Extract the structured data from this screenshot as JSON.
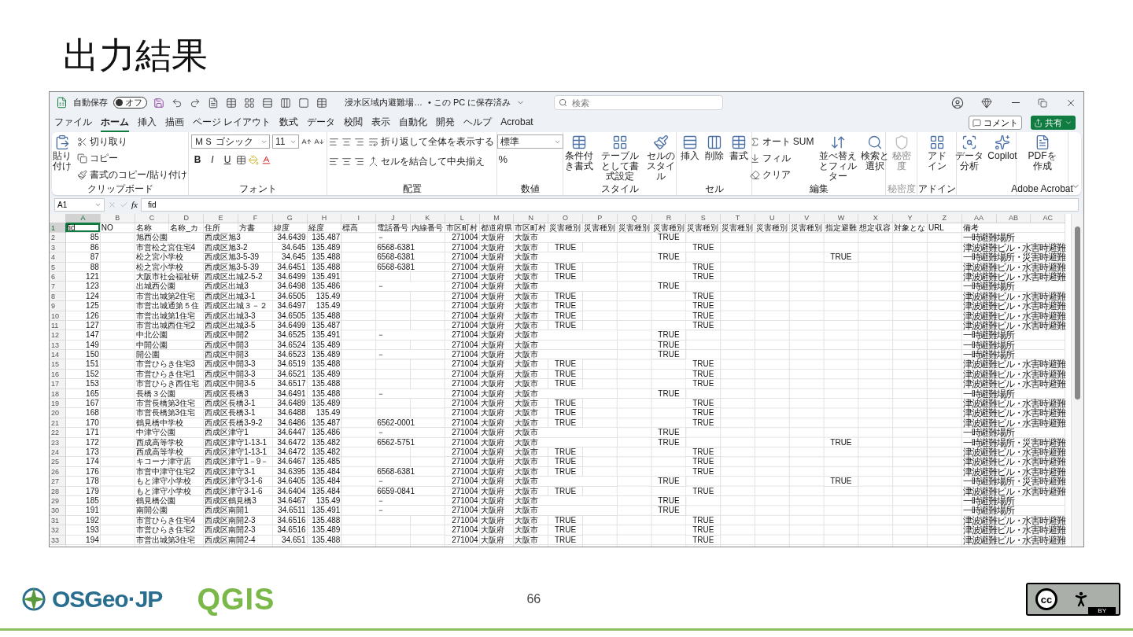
{
  "slide": {
    "title": "出力結果",
    "page_number": "66",
    "osgeo_logo_text": "OSGeo·JP",
    "qgis_logo_text": "QGIS",
    "license_mark": "cc",
    "license_label": "BY"
  },
  "title_bar": {
    "autosave_label": "自動保存",
    "autosave_toggle": {
      "label": "オフ",
      "on": false
    },
    "file_name": "浸水区域内避難場…",
    "save_status": "• この PC に保存済み",
    "search_placeholder": "検索"
  },
  "tabs": [
    {
      "label": "ファイル",
      "selected": false
    },
    {
      "label": "ホーム",
      "selected": true
    },
    {
      "label": "挿入",
      "selected": false
    },
    {
      "label": "描画",
      "selected": false
    },
    {
      "label": "ページ レイアウト",
      "selected": false
    },
    {
      "label": "数式",
      "selected": false
    },
    {
      "label": "データ",
      "selected": false
    },
    {
      "label": "校閲",
      "selected": false
    },
    {
      "label": "表示",
      "selected": false
    },
    {
      "label": "自動化",
      "selected": false
    },
    {
      "label": "開発",
      "selected": false
    },
    {
      "label": "ヘルプ",
      "selected": false
    },
    {
      "label": "Acrobat",
      "selected": false
    }
  ],
  "comment_button": "コメント",
  "share_button": "共有",
  "ribbon": {
    "groups": [
      {
        "label": "クリップボード",
        "disabled": false,
        "items": [
          {
            "label": "貼り付け"
          },
          {
            "label": "切り取り"
          },
          {
            "label": "コピー"
          },
          {
            "label": "書式のコピー/貼り付け"
          }
        ]
      },
      {
        "label": "フォント",
        "disabled": false,
        "items": [
          {
            "value": "ＭＳ ゴシック"
          },
          {
            "value": "11"
          },
          {
            "label": "B"
          },
          {
            "label": "I"
          },
          {
            "label": "U"
          }
        ]
      },
      {
        "label": "配置",
        "disabled": false,
        "items": [
          {
            "label": "折り返して全体を表示する"
          },
          {
            "label": "セルを結合して中央揃え"
          }
        ]
      },
      {
        "label": "数値",
        "disabled": false,
        "items": [
          {
            "value": "標準"
          },
          {
            "label": "%"
          }
        ]
      },
      {
        "label": "スタイル",
        "disabled": false,
        "items": [
          {
            "label": "条件付き書式"
          },
          {
            "label": "テーブルとして書式設定"
          },
          {
            "label": "セルのスタイル"
          }
        ]
      },
      {
        "label": "セル",
        "disabled": false,
        "items": [
          {
            "label": "挿入"
          },
          {
            "label": "削除"
          },
          {
            "label": "書式"
          }
        ]
      },
      {
        "label": "編集",
        "disabled": false,
        "items": [
          {
            "label": "オート SUM"
          },
          {
            "label": "フィル"
          },
          {
            "label": "クリア"
          },
          {
            "label": "並べ替えとフィルター"
          },
          {
            "label": "検索と選択"
          }
        ]
      },
      {
        "label": "秘密度",
        "disabled": true,
        "items": [
          {
            "label": "秘密度"
          }
        ]
      },
      {
        "label": "アドイン",
        "disabled": false,
        "items": [
          {
            "label": "アドイン"
          }
        ]
      },
      {
        "disabled": false,
        "items": [
          {
            "label": "データ分析"
          },
          {
            "label": "Copilot"
          }
        ]
      },
      {
        "label": "Adobe Acrobat",
        "disabled": false,
        "items": [
          {
            "label": "PDFを作成"
          }
        ]
      }
    ]
  },
  "formula_bar": {
    "name_box": "A1",
    "function_label": "fx",
    "value": "fid"
  },
  "sheet": {
    "columns": [
      {
        "label": "A",
        "selected": true
      },
      {
        "label": "B",
        "selected": false
      },
      {
        "label": "C",
        "selected": false
      },
      {
        "label": "D",
        "selected": false
      },
      {
        "label": "E",
        "selected": false
      },
      {
        "label": "F",
        "selected": false
      },
      {
        "label": "G",
        "selected": false
      },
      {
        "label": "H",
        "selected": false
      },
      {
        "label": "I",
        "selected": false
      },
      {
        "label": "J",
        "selected": false
      },
      {
        "label": "K",
        "selected": false
      },
      {
        "label": "L",
        "selected": false
      },
      {
        "label": "M",
        "selected": false
      },
      {
        "label": "N",
        "selected": false
      },
      {
        "label": "O",
        "selected": false
      },
      {
        "label": "P",
        "selected": false
      },
      {
        "label": "Q",
        "selected": false
      },
      {
        "label": "R",
        "selected": false
      },
      {
        "label": "S",
        "selected": false
      },
      {
        "label": "T",
        "selected": false
      },
      {
        "label": "U",
        "selected": false
      },
      {
        "label": "V",
        "selected": false
      },
      {
        "label": "W",
        "selected": false
      },
      {
        "label": "X",
        "selected": false
      },
      {
        "label": "Y",
        "selected": false
      },
      {
        "label": "Z",
        "selected": false
      },
      {
        "label": "AA",
        "selected": false
      },
      {
        "label": "AB",
        "selected": false
      },
      {
        "label": "AC",
        "selected": false
      }
    ],
    "rows": [
      {
        "number": "1",
        "selected": true,
        "cells": {
          "A": "fid",
          "B": "NO",
          "C": "名称",
          "D": "名称_カ",
          "E": "住所",
          "F": "方書",
          "G": "緯度",
          "H": "経度",
          "I": "標高",
          "J": "電話番号",
          "K": "内線番号",
          "L": "市区町村",
          "M": "都道府県",
          "N": "市区町村",
          "O": "災害種別",
          "P": "災害種別",
          "Q": "災害種別",
          "R": "災害種別",
          "S": "災害種別",
          "T": "災害種別",
          "U": "災害種別",
          "V": "災害種別",
          "W": "指定避難",
          "X": "想定収容",
          "Y": "対象とな",
          "Z": "URL",
          "AA": "備考"
        }
      },
      {
        "number": "2",
        "selected": false,
        "cells": {
          "A": "85",
          "C": "旭西公園",
          "E": "西成区旭3",
          "G": "34.6439",
          "H": "135.487",
          "J": "－",
          "L": "271004",
          "M": "大阪府",
          "N": "大阪市",
          "R": "TRUE",
          "AA": "一時避難場所"
        }
      },
      {
        "number": "3",
        "selected": false,
        "cells": {
          "A": "86",
          "C": "市営松之宮住宅4",
          "E": "西成区旭3-2",
          "G": "34.645",
          "H": "135.489",
          "J": "6568-6381",
          "L": "271004",
          "M": "大阪府",
          "N": "大阪市",
          "O": "TRUE",
          "S": "TRUE",
          "AA": "津波避難ビル・水害時避難"
        }
      },
      {
        "number": "4",
        "selected": false,
        "cells": {
          "A": "87",
          "C": "松之宮小学校",
          "E": "西成区旭3-5-39",
          "G": "34.645",
          "H": "135.488",
          "J": "6568-6381",
          "L": "271004",
          "M": "大阪府",
          "N": "大阪市",
          "R": "TRUE",
          "W": "TRUE",
          "AA": "一時避難場所・災害時避難"
        }
      },
      {
        "number": "5",
        "selected": false,
        "cells": {
          "A": "88",
          "C": "松之宮小学校",
          "E": "西成区旭3-5-39",
          "G": "34.6451",
          "H": "135.488",
          "J": "6568-6381",
          "L": "271004",
          "M": "大阪府",
          "N": "大阪市",
          "O": "TRUE",
          "S": "TRUE",
          "AA": "津波避難ビル・水害時避難"
        }
      },
      {
        "number": "6",
        "selected": false,
        "cells": {
          "A": "121",
          "C": "大阪市社会福祉研",
          "E": "西成区出城2-5-2",
          "G": "34.6499",
          "H": "135.491",
          "L": "271004",
          "M": "大阪府",
          "N": "大阪市",
          "O": "TRUE",
          "S": "TRUE",
          "AA": "津波避難ビル・水害時避難"
        }
      },
      {
        "number": "7",
        "selected": false,
        "cells": {
          "A": "123",
          "C": "出城西公園",
          "E": "西成区出城3",
          "G": "34.6498",
          "H": "135.486",
          "J": "－",
          "L": "271004",
          "M": "大阪府",
          "N": "大阪市",
          "R": "TRUE",
          "AA": "一時避難場所"
        }
      },
      {
        "number": "8",
        "selected": false,
        "cells": {
          "A": "124",
          "C": "市営出城第2住宅",
          "E": "西成区出城3-1",
          "G": "34.6505",
          "H": "135.49",
          "L": "271004",
          "M": "大阪府",
          "N": "大阪市",
          "O": "TRUE",
          "S": "TRUE",
          "AA": "津波避難ビル・水害時避難"
        }
      },
      {
        "number": "9",
        "selected": false,
        "cells": {
          "A": "125",
          "C": "市営出城通第５住",
          "E": "西成区出城３－２",
          "G": "34.6497",
          "H": "135.49",
          "L": "271004",
          "M": "大阪府",
          "N": "大阪市",
          "O": "TRUE",
          "S": "TRUE",
          "AA": "津波避難ビル・水害時避難"
        }
      },
      {
        "number": "10",
        "selected": false,
        "cells": {
          "A": "126",
          "C": "市営出城第1住宅",
          "E": "西成区出城3-3",
          "G": "34.6505",
          "H": "135.488",
          "L": "271004",
          "M": "大阪府",
          "N": "大阪市",
          "O": "TRUE",
          "S": "TRUE",
          "AA": "津波避難ビル・水害時避難"
        }
      },
      {
        "number": "11",
        "selected": false,
        "cells": {
          "A": "127",
          "C": "市営出城西住宅2",
          "E": "西成区出城3-5",
          "G": "34.6499",
          "H": "135.487",
          "L": "271004",
          "M": "大阪府",
          "N": "大阪市",
          "O": "TRUE",
          "S": "TRUE",
          "AA": "津波避難ビル・水害時避難"
        }
      },
      {
        "number": "12",
        "selected": false,
        "cells": {
          "A": "147",
          "C": "中北公園",
          "E": "西成区中開2",
          "G": "34.6525",
          "H": "135.491",
          "J": "－",
          "L": "271004",
          "M": "大阪府",
          "N": "大阪市",
          "R": "TRUE",
          "AA": "一時避難場所"
        }
      },
      {
        "number": "13",
        "selected": false,
        "cells": {
          "A": "149",
          "C": "中開公園",
          "E": "西成区中開3",
          "G": "34.6524",
          "H": "135.489",
          "L": "271004",
          "M": "大阪府",
          "N": "大阪市",
          "R": "TRUE",
          "AA": "一時避難場所"
        }
      },
      {
        "number": "14",
        "selected": false,
        "cells": {
          "A": "150",
          "C": "開公園",
          "E": "西成区中開3",
          "G": "34.6523",
          "H": "135.489",
          "J": "－",
          "L": "271004",
          "M": "大阪府",
          "N": "大阪市",
          "R": "TRUE",
          "AA": "一時避難場所"
        }
      },
      {
        "number": "15",
        "selected": false,
        "cells": {
          "A": "151",
          "C": "市営ひらき住宅3",
          "E": "西成区中開3-3",
          "G": "34.6519",
          "H": "135.488",
          "L": "271004",
          "M": "大阪府",
          "N": "大阪市",
          "O": "TRUE",
          "S": "TRUE",
          "AA": "津波避難ビル・水害時避難"
        }
      },
      {
        "number": "16",
        "selected": false,
        "cells": {
          "A": "152",
          "C": "市営ひらき住宅1",
          "E": "西成区中開3-3",
          "G": "34.6521",
          "H": "135.489",
          "L": "271004",
          "M": "大阪府",
          "N": "大阪市",
          "O": "TRUE",
          "S": "TRUE",
          "AA": "津波避難ビル・水害時避難"
        }
      },
      {
        "number": "17",
        "selected": false,
        "cells": {
          "A": "153",
          "C": "市営ひらき西住宅",
          "E": "西成区中開3-5",
          "G": "34.6517",
          "H": "135.488",
          "L": "271004",
          "M": "大阪府",
          "N": "大阪市",
          "O": "TRUE",
          "S": "TRUE",
          "AA": "津波避難ビル・水害時避難"
        }
      },
      {
        "number": "18",
        "selected": false,
        "cells": {
          "A": "165",
          "C": "長橋３公園",
          "E": "西成区長橋3",
          "G": "34.6491",
          "H": "135.488",
          "J": "－",
          "L": "271004",
          "M": "大阪府",
          "N": "大阪市",
          "R": "TRUE",
          "AA": "一時避難場所"
        }
      },
      {
        "number": "19",
        "selected": false,
        "cells": {
          "A": "167",
          "C": "市営長橋第3住宅",
          "E": "西成区長橋3-1",
          "G": "34.6489",
          "H": "135.489",
          "L": "271004",
          "M": "大阪府",
          "N": "大阪市",
          "O": "TRUE",
          "S": "TRUE",
          "AA": "津波避難ビル・水害時避難"
        }
      },
      {
        "number": "20",
        "selected": false,
        "cells": {
          "A": "168",
          "C": "市営長橋第3住宅",
          "E": "西成区長橋3-1",
          "G": "34.6488",
          "H": "135.49",
          "L": "271004",
          "M": "大阪府",
          "N": "大阪市",
          "O": "TRUE",
          "S": "TRUE",
          "AA": "津波避難ビル・水害時避難"
        }
      },
      {
        "number": "21",
        "selected": false,
        "cells": {
          "A": "170",
          "C": "鶴見橋中学校",
          "E": "西成区長橋3-9-2",
          "G": "34.6486",
          "H": "135.487",
          "J": "6562-0001",
          "L": "271004",
          "M": "大阪府",
          "N": "大阪市",
          "O": "TRUE",
          "S": "TRUE",
          "AA": "津波避難ビル・水害時避難"
        }
      },
      {
        "number": "22",
        "selected": false,
        "cells": {
          "A": "171",
          "C": "中津守公園",
          "E": "西成区津守1",
          "G": "34.6447",
          "H": "135.486",
          "J": "－",
          "L": "271004",
          "M": "大阪府",
          "N": "大阪市",
          "R": "TRUE",
          "AA": "一時避難場所"
        }
      },
      {
        "number": "23",
        "selected": false,
        "cells": {
          "A": "172",
          "C": "西成高等学校",
          "E": "西成区津守1-13-1",
          "G": "34.6472",
          "H": "135.482",
          "J": "6562-5751",
          "L": "271004",
          "M": "大阪府",
          "N": "大阪市",
          "R": "TRUE",
          "W": "TRUE",
          "AA": "一時避難場所・災害時避難"
        }
      },
      {
        "number": "24",
        "selected": false,
        "cells": {
          "A": "173",
          "C": "西成高等学校",
          "E": "西成区津守1-13-1",
          "G": "34.6472",
          "H": "135.482",
          "L": "271004",
          "M": "大阪府",
          "N": "大阪市",
          "O": "TRUE",
          "S": "TRUE",
          "AA": "津波避難ビル・水害時避難"
        }
      },
      {
        "number": "25",
        "selected": false,
        "cells": {
          "A": "174",
          "C": "キコーナ津守店",
          "E": "西成区津守1－9－",
          "G": "34.6467",
          "H": "135.485",
          "L": "271004",
          "M": "大阪府",
          "N": "大阪市",
          "O": "TRUE",
          "S": "TRUE",
          "AA": "津波避難ビル・水害時避難"
        }
      },
      {
        "number": "26",
        "selected": false,
        "cells": {
          "A": "176",
          "C": "市営中津守住宅2",
          "E": "西成区津守3-1",
          "G": "34.6395",
          "H": "135.484",
          "J": "6568-6381",
          "L": "271004",
          "M": "大阪府",
          "N": "大阪市",
          "O": "TRUE",
          "S": "TRUE",
          "AA": "津波避難ビル・水害時避難"
        }
      },
      {
        "number": "27",
        "selected": false,
        "cells": {
          "A": "178",
          "C": "もと津守小学校",
          "E": "西成区津守3-1-6",
          "G": "34.6405",
          "H": "135.484",
          "J": "－",
          "L": "271004",
          "M": "大阪府",
          "N": "大阪市",
          "R": "TRUE",
          "W": "TRUE",
          "AA": "一時避難場所・災害時避難"
        }
      },
      {
        "number": "28",
        "selected": false,
        "cells": {
          "A": "179",
          "C": "もと津守小学校",
          "E": "西成区津守3-1-6",
          "G": "34.6404",
          "H": "135.484",
          "J": "6659-0841",
          "L": "271004",
          "M": "大阪府",
          "N": "大阪市",
          "O": "TRUE",
          "S": "TRUE",
          "AA": "津波避難ビル・水害時避難"
        }
      },
      {
        "number": "29",
        "selected": false,
        "cells": {
          "A": "185",
          "C": "鶴見橋公園",
          "E": "西成区鶴見橋3",
          "G": "34.6467",
          "H": "135.49",
          "J": "－",
          "L": "271004",
          "M": "大阪府",
          "N": "大阪市",
          "R": "TRUE",
          "AA": "一時避難場所"
        }
      },
      {
        "number": "30",
        "selected": false,
        "cells": {
          "A": "191",
          "C": "南開公園",
          "E": "西成区南開1",
          "G": "34.6511",
          "H": "135.491",
          "J": "－",
          "L": "271004",
          "M": "大阪府",
          "N": "大阪市",
          "R": "TRUE",
          "AA": "一時避難場所"
        }
      },
      {
        "number": "31",
        "selected": false,
        "cells": {
          "A": "192",
          "C": "市営ひらき住宅4",
          "E": "西成区南開2-3",
          "G": "34.6516",
          "H": "135.488",
          "L": "271004",
          "M": "大阪府",
          "N": "大阪市",
          "O": "TRUE",
          "S": "TRUE",
          "AA": "津波避難ビル・水害時避難"
        }
      },
      {
        "number": "32",
        "selected": false,
        "cells": {
          "A": "193",
          "C": "市営ひらき住宅2",
          "E": "西成区南開2-3",
          "G": "34.6516",
          "H": "135.489",
          "L": "271004",
          "M": "大阪府",
          "N": "大阪市",
          "O": "TRUE",
          "S": "TRUE",
          "AA": "津波避難ビル・水害時避難"
        }
      },
      {
        "number": "33",
        "selected": false,
        "cells": {
          "A": "194",
          "C": "市営出城第3住宅",
          "E": "西成区南開2-4",
          "G": "34.651",
          "H": "135.488",
          "L": "271004",
          "M": "大阪府",
          "N": "大阪市",
          "O": "TRUE",
          "S": "TRUE",
          "AA": "津波避難ビル・水害時避難"
        }
      }
    ]
  }
}
